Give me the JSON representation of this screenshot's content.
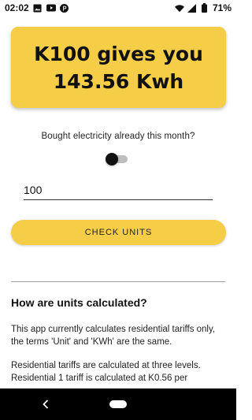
{
  "status_bar": {
    "time": "02:02",
    "battery": "71%",
    "icons": [
      "image-icon",
      "youtube-icon",
      "p-app-icon",
      "wifi-icon",
      "signal-icon",
      "battery-icon"
    ]
  },
  "result": {
    "line1": "K100 gives you",
    "line2": "143.56 Kwh"
  },
  "question": "Bought electricity already this month?",
  "toggle": {
    "on": false
  },
  "amount_input": {
    "value": "100"
  },
  "check_button_label": "CHECK UNITS",
  "info": {
    "heading": "How are units calculated?",
    "paragraph1": "This app currently calculates residential tariffs only, the terms 'Unit' and 'KWh' are the same.",
    "paragraph2": "Residential tariffs are calculated at three levels. Residential 1 tariff is calculated at K0.56 per"
  },
  "colors": {
    "accent": "#f5cd47",
    "text": "#111111",
    "nav_bar": "#000000"
  }
}
